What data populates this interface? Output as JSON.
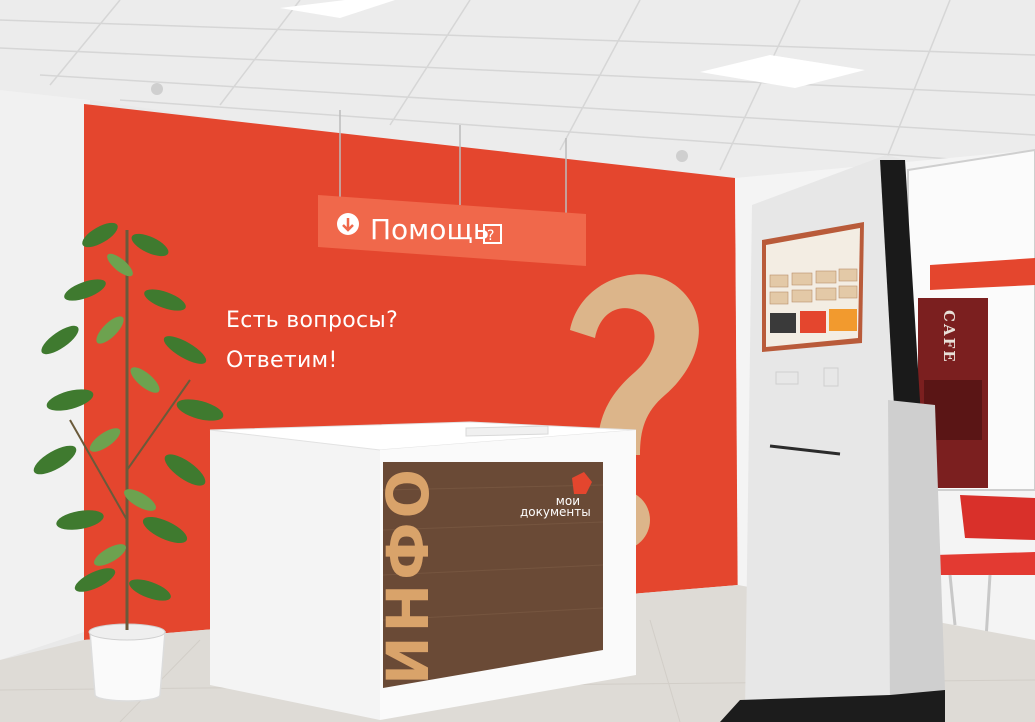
{
  "scene": {
    "description_label": "Help desk reception area"
  },
  "sign": {
    "text": "Помощь",
    "arrow_icon": "down-arrow-circle-icon",
    "question_icon": "question-box-icon"
  },
  "wall": {
    "line1": "Есть вопросы?",
    "line2": "Ответим!",
    "accent_color": "#e4462e"
  },
  "desk": {
    "panel_text": "ИНФО",
    "logo_line1": "мои",
    "logo_line2": "документы"
  },
  "cafe": {
    "label": "CAFE"
  }
}
